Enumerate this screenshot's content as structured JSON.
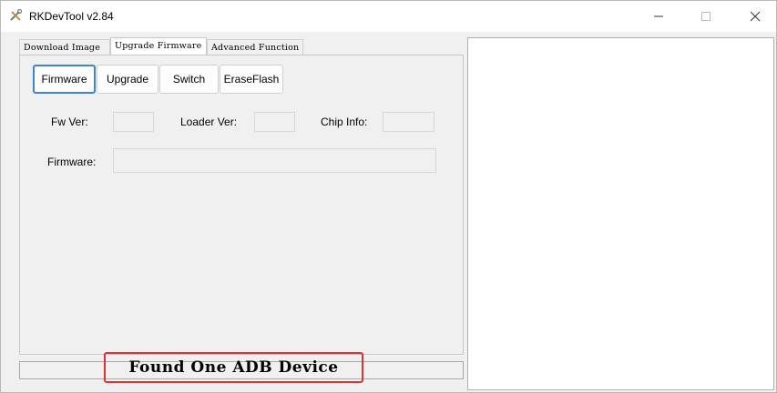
{
  "window": {
    "title": "RKDevTool v2.84",
    "app_icon": "tools-icon",
    "controls": {
      "minimize_icon": "minimize-icon",
      "maximize_icon": "maximize-icon",
      "close_icon": "close-icon"
    }
  },
  "tabs": [
    {
      "label": "Download Image"
    },
    {
      "label": "Upgrade Firmware",
      "selected": true
    },
    {
      "label": "Advanced Function"
    }
  ],
  "buttons": {
    "firmware": "Firmware",
    "upgrade": "Upgrade",
    "switch": "Switch",
    "erase_flash": "EraseFlash"
  },
  "info": {
    "fw_ver_label": "Fw Ver:",
    "fw_ver_value": "",
    "loader_ver_label": "Loader Ver:",
    "loader_ver_value": "",
    "chip_info_label": "Chip Info:",
    "chip_info_value": "",
    "firmware_label": "Firmware:",
    "firmware_value": ""
  },
  "status": {
    "message": "Found One ADB Device",
    "highlight_color": "#e03030"
  },
  "log": {
    "content": ""
  }
}
